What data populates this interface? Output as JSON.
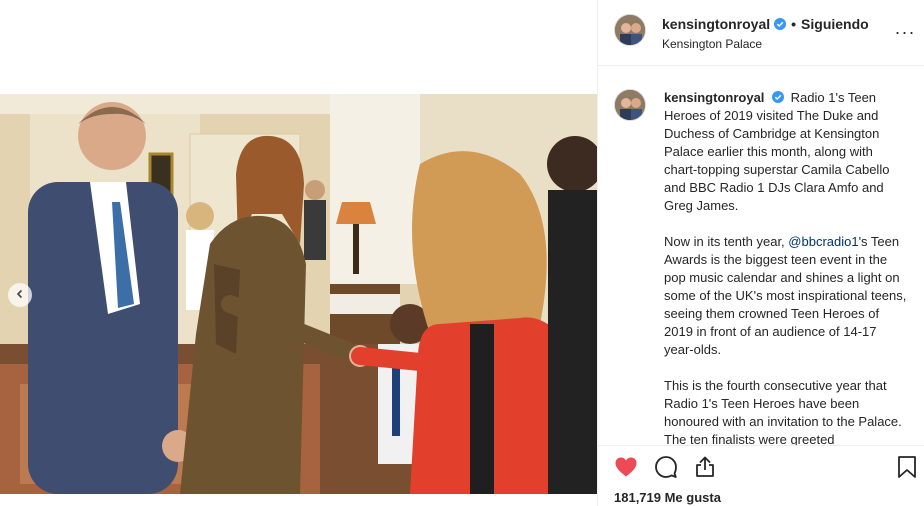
{
  "post": {
    "username": "kensingtonroyal",
    "follow_separator": "•",
    "follow_label": "Siguiendo",
    "location": "Kensington Palace",
    "more_label": "···"
  },
  "caption": {
    "username": "kensingtonroyal",
    "p1": "Radio 1's Teen Heroes of 2019 visited The Duke and Duchess of Cambridge at Kensington Palace earlier this month, along with chart-topping superstar Camila Cabello and BBC Radio 1 DJs Clara Amfo and Greg James.",
    "p2_before": "Now in its tenth year, ",
    "p2_mention": "@bbcradio1",
    "p2_after": "'s Teen Awards is the biggest teen event in the pop music calendar and shines a light on some of the UK's most inspirational teens, seeing them crowned Teen Heroes of 2019 in front of an audience of 14-17 year-olds.",
    "p3": "This is the fourth consecutive year that Radio 1's Teen Heroes have been honoured with an invitation to the Palace. The ten finalists were greeted"
  },
  "actions": {
    "likes_text": "181,719 Me gusta"
  },
  "icons": {
    "like": "heart-icon",
    "comment": "comment-icon",
    "share": "share-icon",
    "save": "bookmark-icon",
    "verified": "verified-badge-icon",
    "prev": "chevron-left-icon"
  },
  "colors": {
    "like_red": "#ed4956",
    "verified_blue": "#3897f0",
    "mention_blue": "#003569",
    "border": "#efefef"
  }
}
